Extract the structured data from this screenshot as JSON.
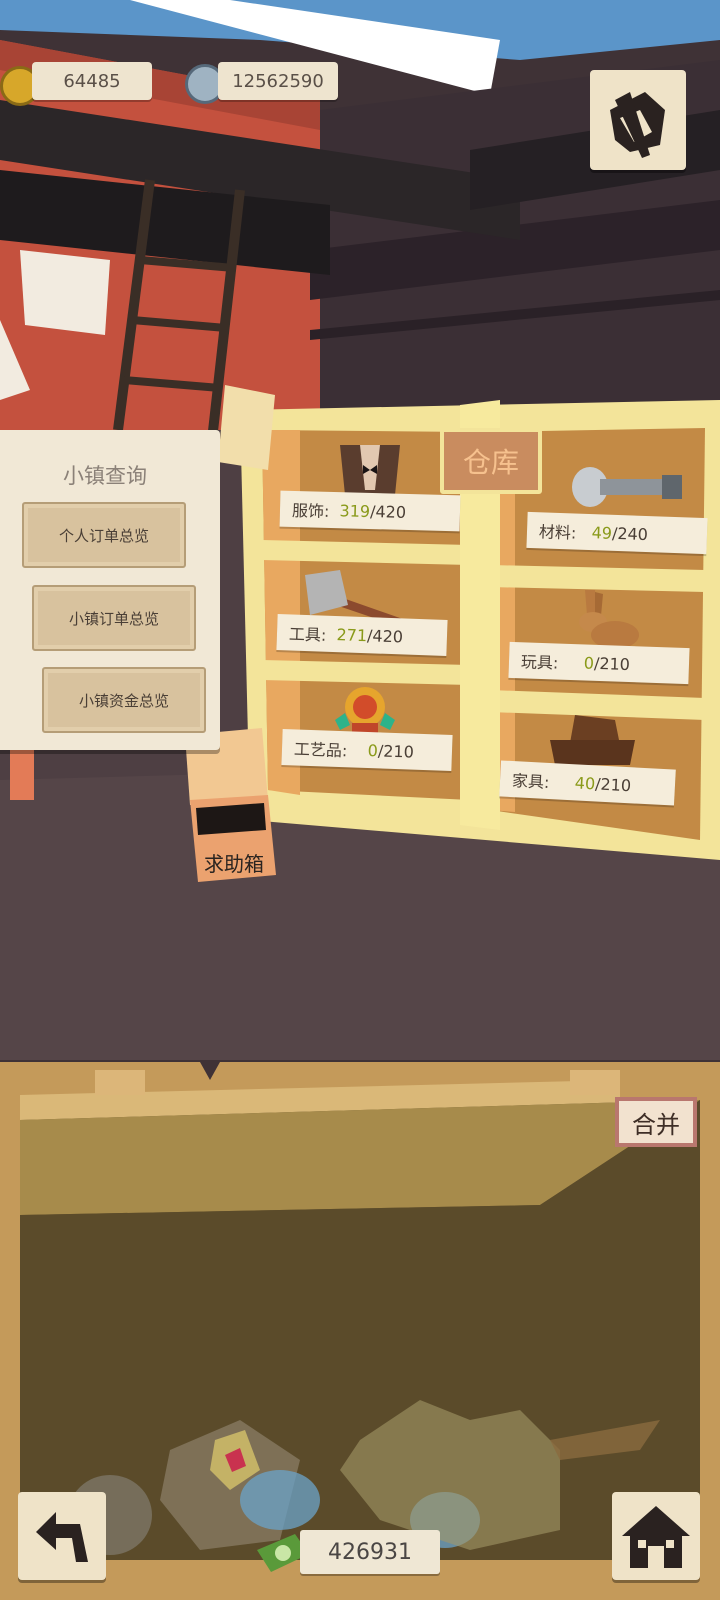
{
  "currency": {
    "gold": "64485",
    "silver": "12562590"
  },
  "board": {
    "title": "小镇查询",
    "buttons": [
      "个人订单总览",
      "小镇订单总览",
      "小镇资金总览"
    ]
  },
  "warehouse": {
    "sign": "仓库",
    "shelves": [
      {
        "label": "服饰:",
        "count": "319",
        "capacity": "/420",
        "icon": "tuxedo-icon"
      },
      {
        "label": "材料:",
        "count": "49",
        "capacity": "/240",
        "icon": "bolt-icon"
      },
      {
        "label": "工具:",
        "count": "271",
        "capacity": "/420",
        "icon": "axe-icon"
      },
      {
        "label": "玩具:",
        "count": "0",
        "capacity": "/210",
        "icon": "rabbit-icon"
      },
      {
        "label": "工艺品:",
        "count": "0",
        "capacity": "/210",
        "icon": "idol-icon"
      },
      {
        "label": "家具:",
        "count": "40",
        "capacity": "/210",
        "icon": "chair-icon"
      }
    ]
  },
  "help_box": "求助箱",
  "bag": {
    "merge_label": "合并",
    "money": "426931"
  },
  "icons": {
    "top_right": "quill-letter-icon",
    "bottom_left": "back-arrow-icon",
    "bottom_right": "home-icon"
  }
}
